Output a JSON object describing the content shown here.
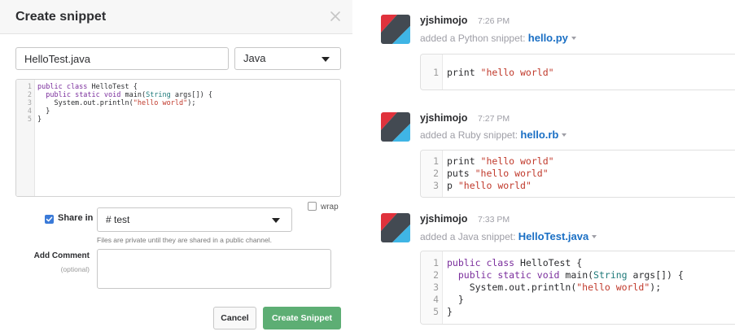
{
  "modal": {
    "title": "Create snippet",
    "filename_value": "HelloTest.java",
    "language": "Java",
    "code_lines": [
      [
        {
          "t": "public class ",
          "c": "kw"
        },
        {
          "t": "HelloTest {",
          "c": ""
        }
      ],
      [
        {
          "t": "  ",
          "c": ""
        },
        {
          "t": "public static void ",
          "c": "kw"
        },
        {
          "t": "main(",
          "c": ""
        },
        {
          "t": "String",
          "c": "ty"
        },
        {
          "t": " args[]) {",
          "c": ""
        }
      ],
      [
        {
          "t": "    System.out.println(",
          "c": ""
        },
        {
          "t": "\"hello world\"",
          "c": "str"
        },
        {
          "t": ");",
          "c": ""
        }
      ],
      [
        {
          "t": "  }",
          "c": ""
        }
      ],
      [
        {
          "t": "}",
          "c": ""
        }
      ]
    ],
    "wrap_label": "wrap",
    "share_label": "Share in",
    "channel": "# test",
    "share_hint": "Files are private until they are shared in a public channel.",
    "comment_label": "Add Comment",
    "comment_optional": "(optional)",
    "cancel_label": "Cancel",
    "create_label": "Create Snippet"
  },
  "messages": [
    {
      "username": "yjshimojo",
      "time": "7:26 PM",
      "prefix": "added a Python snippet: ",
      "filename": "hello.py",
      "lines": [
        [
          {
            "t": "print ",
            "c": ""
          },
          {
            "t": "\"hello world\"",
            "c": "str"
          }
        ]
      ]
    },
    {
      "username": "yjshimojo",
      "time": "7:27 PM",
      "prefix": "added a Ruby snippet: ",
      "filename": "hello.rb",
      "lines": [
        [
          {
            "t": "print ",
            "c": ""
          },
          {
            "t": "\"hello world\"",
            "c": "str"
          }
        ],
        [
          {
            "t": "puts ",
            "c": ""
          },
          {
            "t": "\"hello world\"",
            "c": "str"
          }
        ],
        [
          {
            "t": "p ",
            "c": ""
          },
          {
            "t": "\"hello world\"",
            "c": "str"
          }
        ]
      ]
    },
    {
      "username": "yjshimojo",
      "time": "7:33 PM",
      "prefix": "added a Java snippet: ",
      "filename": "HelloTest.java",
      "lines": [
        [
          {
            "t": "public class ",
            "c": "kw"
          },
          {
            "t": "HelloTest {",
            "c": ""
          }
        ],
        [
          {
            "t": "  ",
            "c": ""
          },
          {
            "t": "public static void ",
            "c": "kw"
          },
          {
            "t": "main(",
            "c": ""
          },
          {
            "t": "String",
            "c": "ty"
          },
          {
            "t": " args[]) {",
            "c": ""
          }
        ],
        [
          {
            "t": "    System.out.println(",
            "c": ""
          },
          {
            "t": "\"hello world\"",
            "c": "str"
          },
          {
            "t": ");",
            "c": ""
          }
        ],
        [
          {
            "t": "  }",
            "c": ""
          }
        ],
        [
          {
            "t": "}",
            "c": ""
          }
        ]
      ]
    }
  ],
  "colors": {
    "accent_blue": "#1a6fc4",
    "create_button": "#5dae74",
    "checkbox": "#3a7ad8",
    "string": "#c0392b",
    "keyword": "#7a2d9c"
  },
  "icons": {
    "close": "close-icon",
    "avatar": "avatar-icon",
    "dropdown": "chevron-down-icon",
    "checkbox": "checkbox-checked-icon"
  }
}
